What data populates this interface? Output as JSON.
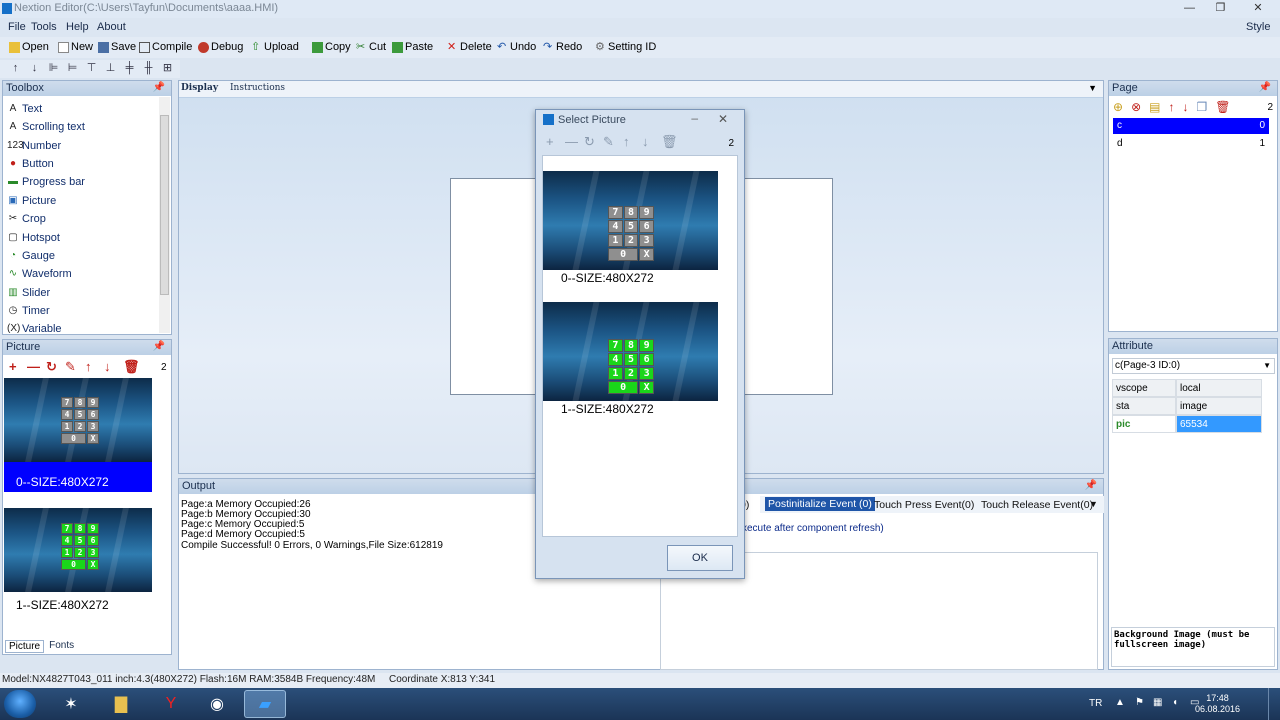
{
  "window": {
    "title": "Nextion Editor(C:\\Users\\Tayfun\\Documents\\aaaa.HMI)",
    "minimize": "—",
    "maximize": "❐",
    "close": "✕"
  },
  "menu": {
    "file": "File",
    "tools": "Tools",
    "help": "Help",
    "about": "About",
    "style": "Style"
  },
  "toolbar": {
    "open": "Open",
    "new": "New",
    "save": "Save",
    "compile": "Compile",
    "debug": "Debug",
    "upload": "Upload",
    "copy": "Copy",
    "cut": "Cut",
    "paste": "Paste",
    "delete": "Delete",
    "undo": "Undo",
    "redo": "Redo",
    "setting_id": "Setting ID"
  },
  "toolbox": {
    "title": "Toolbox",
    "items": [
      "Text",
      "Scrolling text",
      "Number",
      "Button",
      "Progress bar",
      "Picture",
      "Crop",
      "Hotspot",
      "Gauge",
      "Waveform",
      "Slider",
      "Timer",
      "Variable"
    ],
    "icons": [
      "A",
      "A",
      "123",
      "●",
      "▬",
      "▣",
      "✂",
      "▢",
      "◔",
      "∿",
      "▥",
      "◷",
      "(X)"
    ]
  },
  "picture_panel": {
    "title": "Picture",
    "count": "2",
    "items": [
      {
        "label": "0--SIZE:480X272",
        "keypad_color": "gray"
      },
      {
        "label": "1--SIZE:480X272",
        "keypad_color": "green"
      }
    ],
    "tabs": {
      "picture": "Picture",
      "fonts": "Fonts"
    }
  },
  "keypad": {
    "keys": [
      "7",
      "8",
      "9",
      "4",
      "5",
      "6",
      "1",
      "2",
      "3",
      "0",
      "X"
    ]
  },
  "canvas": {
    "tab_display": "Display",
    "tab_instructions": "Instructions"
  },
  "output": {
    "title": "Output",
    "lines": [
      "Page:a Memory Occupied:26",
      "Page:b Memory Occupied:30",
      "Page:c Memory Occupied:5",
      "Page:d Memory Occupied:5",
      "Compile Successful! 0 Errors, 0 Warnings,File Size:612819"
    ]
  },
  "events": {
    "preinit_fragment": "0)",
    "postinit": "Postinitialize Event (0)",
    "touch_press": "Touch Press Event(0)",
    "touch_release": "Touch Release Event(0)",
    "note": "xecute after component refresh)"
  },
  "page_panel": {
    "title": "Page",
    "count": "2",
    "pages": [
      {
        "name": "c",
        "index": "0",
        "selected": true
      },
      {
        "name": "d",
        "index": "1",
        "selected": false
      }
    ]
  },
  "attribute_panel": {
    "title": "Attribute",
    "selector": "c(Page-3 ID:0)",
    "rows": [
      {
        "key": "vscope",
        "value": "local"
      },
      {
        "key": "sta",
        "value": "image"
      },
      {
        "key": "pic",
        "value": "65534"
      }
    ],
    "note": "Background Image (must be fullscreen image)"
  },
  "dialog": {
    "title": "Select Picture",
    "count": "2",
    "items": [
      "0--SIZE:480X272",
      "1--SIZE:480X272"
    ],
    "ok": "OK"
  },
  "statusbar": {
    "model": "Model:NX4827T043_011  inch:4.3(480X272) Flash:16M RAM:3584B Frequency:48M",
    "coordinate": "Coordinate X:813  Y:341"
  },
  "taskbar": {
    "lang": "TR",
    "time": "17:48",
    "date": "06.08.2016"
  },
  "colors": {
    "selection": "#0000ff",
    "accent": "#1f55a8",
    "gray_key": "#8f8f8f",
    "green_key": "#1ad61a"
  }
}
